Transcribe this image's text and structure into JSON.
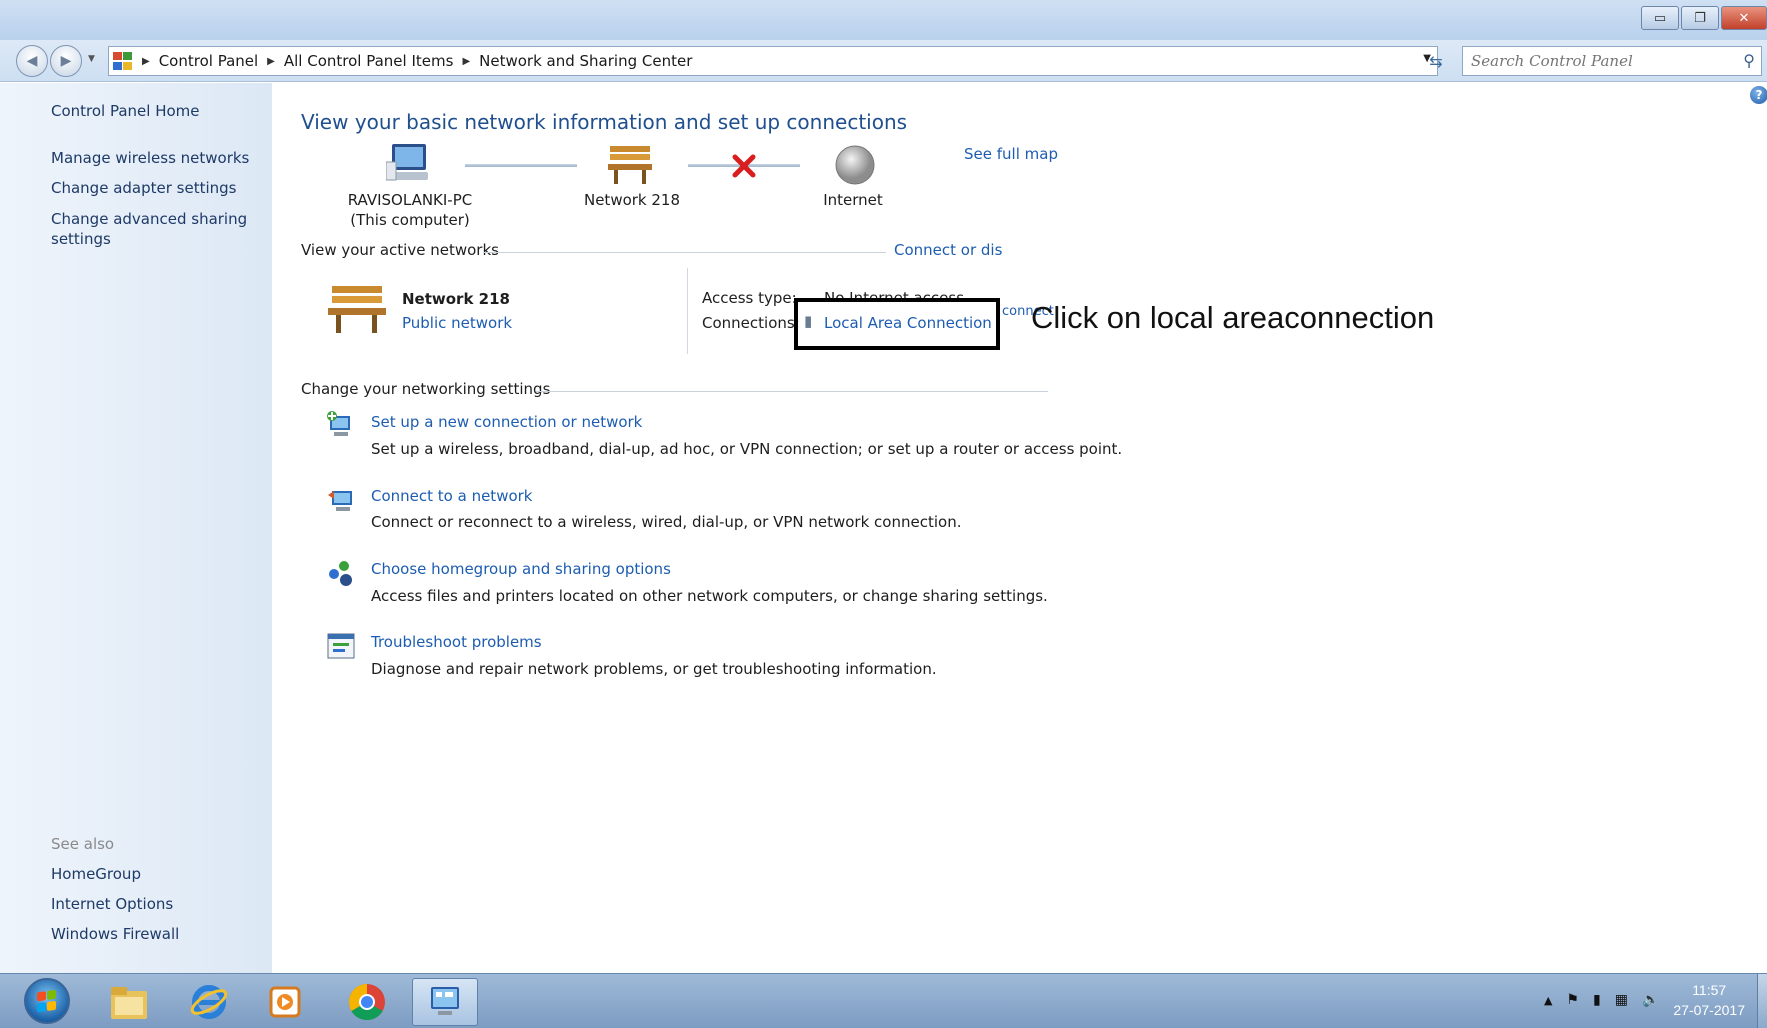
{
  "window": {
    "minimize": "▭",
    "restore": "❐",
    "close": "✕"
  },
  "address": {
    "crumbs": [
      "Control Panel",
      "All Control Panel Items",
      "Network and Sharing Center"
    ],
    "search_placeholder": "Search Control Panel"
  },
  "sidebar": {
    "home": "Control Panel Home",
    "links": [
      "Manage wireless networks",
      "Change adapter settings",
      "Change advanced sharing settings"
    ],
    "see_also": "See also",
    "see_also_links": [
      "HomeGroup",
      "Internet Options",
      "Windows Firewall"
    ]
  },
  "main": {
    "title": "View your basic network information and set up connections",
    "see_full_map": "See full map",
    "computer_name": "RAVISOLANKI-PC",
    "computer_sub": "(This computer)",
    "network_node": "Network  218",
    "internet_node": "Internet",
    "active_networks_label": "View your active networks",
    "connect_or_disconnect": "Connect or dis",
    "network_name": "Network  218",
    "network_type": "Public network",
    "access_type_label": "Access type:",
    "access_type_value": "No Internet access",
    "connections_label": "Connections:",
    "connection_link": "Local Area Connection",
    "connect_fragment": "connect",
    "change_settings_label": "Change your networking settings",
    "tasks": [
      {
        "title": "Set up a new connection or network",
        "desc": "Set up a wireless, broadband, dial-up, ad hoc, or VPN connection; or set up a router or access point."
      },
      {
        "title": "Connect to a network",
        "desc": "Connect or reconnect to a wireless, wired, dial-up, or VPN network connection."
      },
      {
        "title": "Choose homegroup and sharing options",
        "desc": "Access files and printers located on other network computers, or change sharing settings."
      },
      {
        "title": "Troubleshoot problems",
        "desc": "Diagnose and repair network problems, or get troubleshooting information."
      }
    ]
  },
  "annotation": "Click on local areaconnection",
  "taskbar": {
    "time": "11:57",
    "date": "27-07-2017"
  },
  "colors": {
    "link": "#1d5db1",
    "title": "#1f4f8f",
    "sidebar_link": "#1e3a66"
  }
}
